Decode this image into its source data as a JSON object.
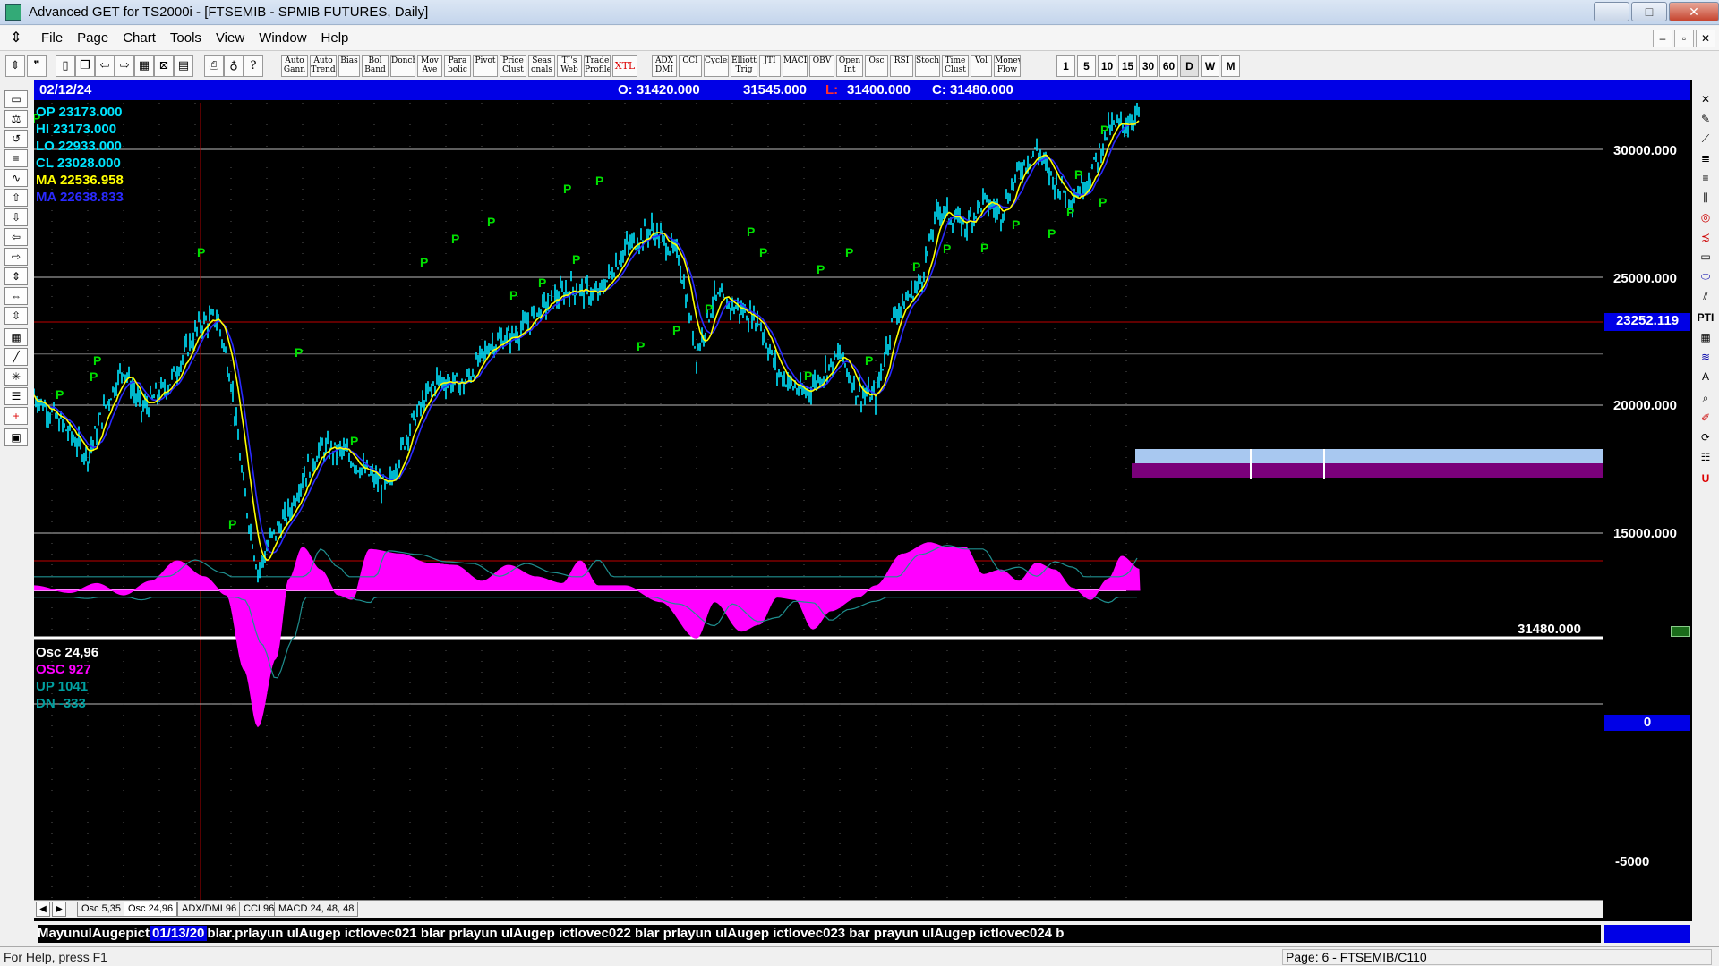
{
  "window": {
    "title": "Advanced GET for TS2000i - [FTSEMIB - SPMIB FUTURES, Daily]",
    "minimize": "—",
    "maximize": "□",
    "close": "✕"
  },
  "menu": {
    "items": [
      "File",
      "Page",
      "Chart",
      "Tools",
      "View",
      "Window",
      "Help"
    ],
    "mdi_min": "‒",
    "mdi_restore": "▫",
    "mdi_close": "✕"
  },
  "toolbar": {
    "study_buttons": [
      "Auto Gann",
      "Auto Trend",
      "Bias",
      "Bol Band",
      "Donch",
      "Mov Ave",
      "Para bolic",
      "Pivot",
      "Price Clust",
      "Seas onals",
      "TJ's Web",
      "Trade Profile",
      "XTL",
      "ADX DMI",
      "CCI",
      "Cycles",
      "Elliott Trig",
      "JTI",
      "MACD",
      "OBV",
      "Open Int",
      "Osc",
      "RSI",
      "Stoch",
      "Time Clust",
      "Vol",
      "Money Flow"
    ],
    "period_buttons": [
      "1",
      "5",
      "10",
      "15",
      "30",
      "60",
      "D",
      "W",
      "M"
    ]
  },
  "header": {
    "date": "02/12/24",
    "open": "O: 31420.000",
    "high": "31545.000",
    "low_label": "L:",
    "low": "31400.000",
    "close": "C: 31480.000"
  },
  "price_info": {
    "op": "OP  23173.000",
    "hi": "HI   23173.000",
    "lo": "LO  22933.000",
    "cl": "CL  23028.000",
    "ma1": "MA  22536.958",
    "ma2": "MA  22638.833"
  },
  "price_axis": {
    "labels": [
      "30000.000",
      "25000.000",
      "20000.000",
      "15000.000"
    ],
    "cursor_value": "23252.119",
    "last_value": "31480.000"
  },
  "osc_info": {
    "title": "Osc 24,96",
    "osc": "OSC 927",
    "up": "UP   1041",
    "dn": "DN   -333"
  },
  "osc_axis": {
    "zero_label": "0",
    "low_label": "-5000"
  },
  "tabs": [
    "Osc 5,35",
    "Osc 24,96",
    "ADX/DMI 96",
    "CCI 96",
    "MACD 24, 48, 48"
  ],
  "time_axis": {
    "prefix": "MayunulAugepict",
    "highlight": "01/13/20",
    "rest": "blar.prlayun ulAugep ictlovec021 blar prlayun ulAugep ictlovec022 blar prlayun ulAugep ictlovec023 bar prayun ulAugep ictlovec024 b"
  },
  "statusbar": {
    "help": "For Help, press F1",
    "page": "Page: 6 - FTSEMIB/C110"
  },
  "colors": {
    "price": "#00e5ff",
    "ma_fast": "#ffff00",
    "ma_slow": "#2a2aff",
    "pivot": "#00e000",
    "osc": "#ff00ff",
    "panel_blue": "#0000e6"
  }
}
